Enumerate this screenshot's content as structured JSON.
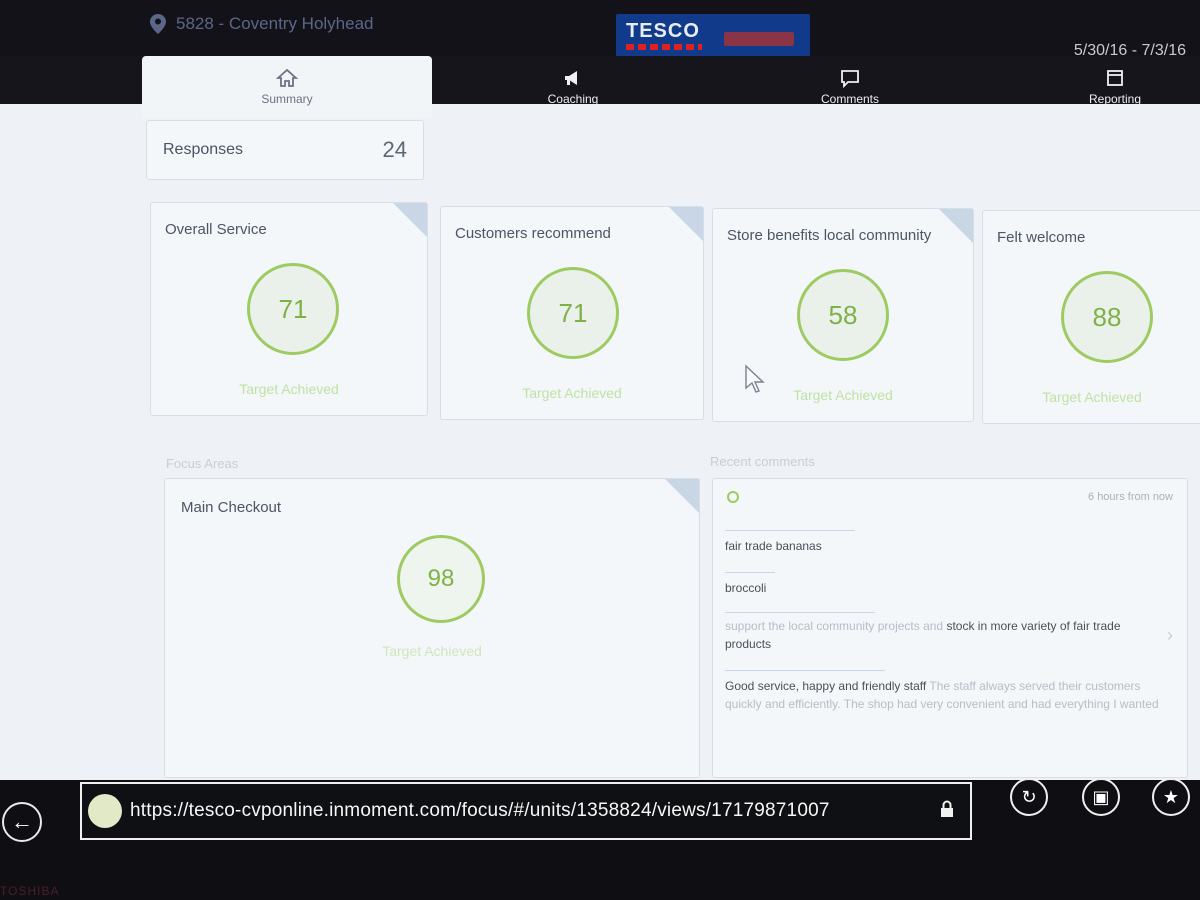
{
  "header": {
    "store_name": "5828 - Coventry Holyhead",
    "logo_text": "TESCO",
    "date_range": "5/30/16 - 7/3/16"
  },
  "tabs": [
    {
      "label": "Summary",
      "icon": "home-icon",
      "active": true
    },
    {
      "label": "Coaching",
      "icon": "megaphone-icon",
      "active": false
    },
    {
      "label": "Comments",
      "icon": "speech-bubble-icon",
      "active": false
    },
    {
      "label": "Reporting",
      "icon": "report-icon",
      "active": false
    }
  ],
  "responses": {
    "label": "Responses",
    "value": "24"
  },
  "metrics": [
    {
      "title": "Overall Service",
      "value": "71",
      "status": "Target Achieved"
    },
    {
      "title": "Customers recommend",
      "value": "71",
      "status": "Target Achieved"
    },
    {
      "title": "Store benefits local community",
      "value": "58",
      "status": "Target Achieved"
    },
    {
      "title": "Felt welcome",
      "value": "88",
      "status": "Target Achieved"
    }
  ],
  "focus": {
    "section_title": "Focus Areas",
    "title": "Main Checkout",
    "value": "98",
    "status": "Target Achieved"
  },
  "comments": {
    "section_title": "Recent comments",
    "time": "6 hours from now",
    "items": [
      {
        "text": "fair trade bananas"
      },
      {
        "text": "broccoli"
      },
      {
        "text_faint": "support the local community projects and",
        "text": "stock in more variety of fair trade products"
      },
      {
        "text": "Good service, happy and friendly staff",
        "text_faint": "The staff always served their customers quickly and efficiently. The shop had very convenient and had everything I wanted"
      }
    ]
  },
  "browser": {
    "url": "https://tesco-cvponline.inmoment.com/focus/#/units/1358824/views/17179871007",
    "brand": "TOSHIBA"
  },
  "colors": {
    "accent_green": "#9dcb62",
    "tesco_blue": "#123a8a",
    "panel": "#eef2f6"
  }
}
